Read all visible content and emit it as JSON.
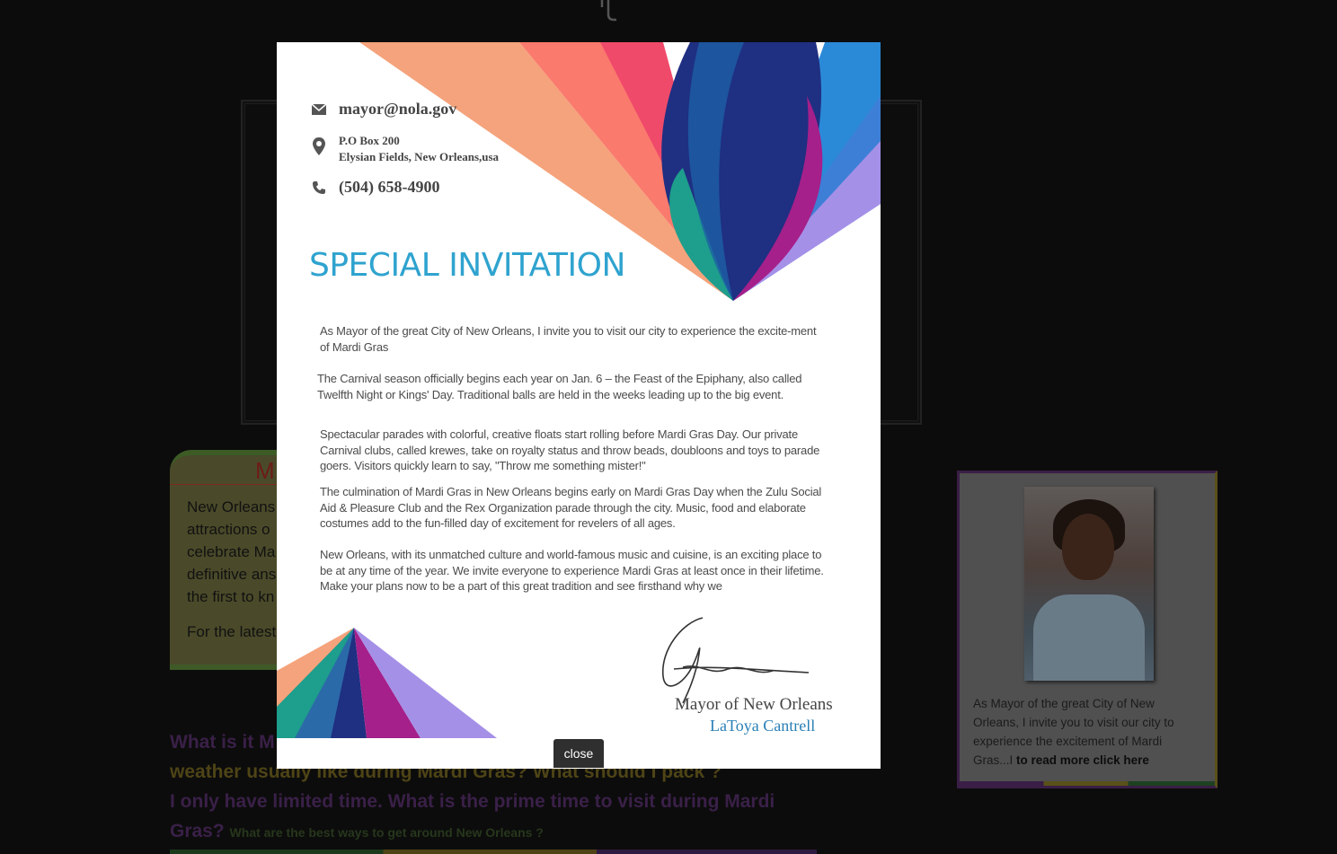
{
  "background": {
    "info_card": {
      "title_fragment": "M",
      "body_lines": [
        "New Orleans",
        "attractions o",
        "celebrate Ma",
        "definitive ans",
        "the first to kn"
      ],
      "footer_line": "For the latest"
    },
    "faq": {
      "q1": "What is it M",
      "q2": "weather usually like during Mardi Gras? What should I pack ?",
      "q3": "I only have limited time. What is the prime time to visit during Mardi Gras?",
      "q4": "What are the best ways to get around New Orleans ?"
    },
    "mayor_card": {
      "blurb": "As Mayor of the great City of New Orleans, I invite you to visit our city to experience the excitement of Mardi Gras...I",
      "read_more": "to read more click here"
    }
  },
  "invitation": {
    "email": "mayor@nola.gov",
    "address_line1": "P.O Box 200",
    "address_line2": "Elysian Fields, New Orleans,usa",
    "phone": "(504) 658-4900",
    "title": "SPECIAL INVITATION",
    "paragraphs": [
      "As Mayor of the great City of New Orleans, I invite you to visit our city to experience the excite-ment of Mardi Gras",
      "The Carnival season officially begins each year on Jan. 6 – the Feast of the Epiphany, also called Twelfth Night or Kings' Day. Traditional balls are held in the weeks leading up to the big event.",
      "Spectacular parades with colorful, creative floats start rolling before Mardi Gras Day. Our private Carnival clubs, called krewes, take on royalty status and throw beads, doubloons and toys to parade goers. Visitors quickly learn to say, \"Throw me something mister!\"",
      "The culmination of Mardi Gras in New Orleans begins early on Mardi Gras Day when the Zulu Social Aid & Pleasure Club and the Rex Organization parade through the city. Music, food and elaborate costumes add to the fun-filled day of excitement for revelers of all ages.",
      "New Orleans, with its unmatched culture and world-famous music and cuisine, is an exciting place to be at any time of the year. We invite everyone to experience Mardi Gras at least once in their lifetime. Make your plans now to be a part of this great tradition and see firsthand why we"
    ],
    "signature_role": "Mayor of New Orleans",
    "signature_name": "LaToya Cantrell",
    "icons": [
      "envelope-icon",
      "map-pin-icon",
      "phone-icon"
    ]
  },
  "modal": {
    "close_label": "close"
  },
  "colors": {
    "title_blue": "#2fa3cf",
    "name_blue": "#2a7fb5",
    "overlay_dark": "#0c0c0c",
    "close_bg": "#2f2f2f"
  }
}
